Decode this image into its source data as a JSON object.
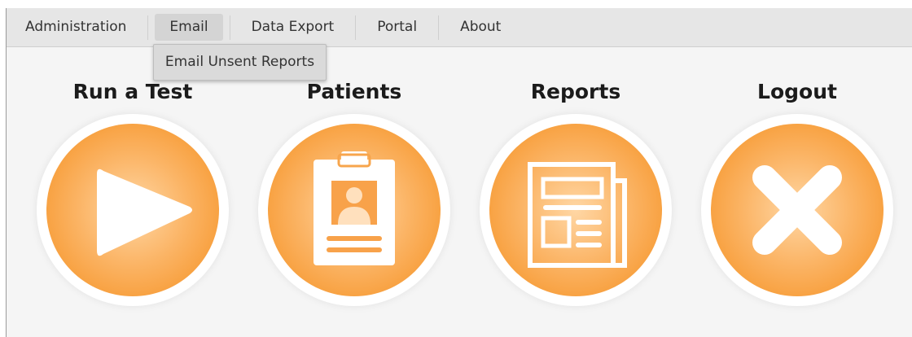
{
  "menu": {
    "items": [
      {
        "label": "Administration"
      },
      {
        "label": "Email"
      },
      {
        "label": "Data Export"
      },
      {
        "label": "Portal"
      },
      {
        "label": "About"
      }
    ],
    "active_item": "Email",
    "dropdown": {
      "items": [
        {
          "label": "Email Unsent Reports"
        }
      ]
    }
  },
  "tiles": [
    {
      "title": "Run a Test",
      "icon": "play-icon"
    },
    {
      "title": "Patients",
      "icon": "clipboard-id-icon"
    },
    {
      "title": "Reports",
      "icon": "newspaper-icon"
    },
    {
      "title": "Logout",
      "icon": "close-x-icon"
    }
  ],
  "colors": {
    "accent_orange": "#f58e1c",
    "accent_light": "#ffd7a5",
    "menubar_bg": "#e6e6e6",
    "page_bg": "#f5f5f5"
  }
}
